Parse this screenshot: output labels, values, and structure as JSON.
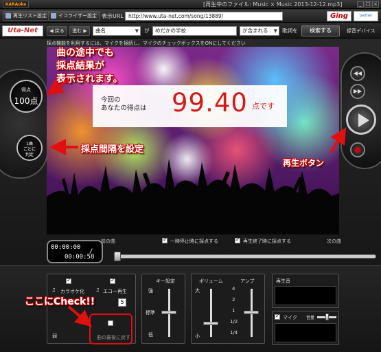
{
  "titlebar": {
    "logo_text": "KARAoke",
    "title": "[再生中のファイル: Music × Music  2013-12-12.mp3]",
    "buttons": [
      "_",
      "□",
      "×"
    ]
  },
  "toolbar": {
    "playlist_label": "再生リスト設定",
    "equalizer_label": "イコライザー設定",
    "url_label": "表示URL :",
    "url_value": "http://www.uta-net.com/song/13889/",
    "ging_logo": "Ging",
    "partner_logo": "partner"
  },
  "searchbar": {
    "site_logo": "Uta-Net",
    "back_label": "◀ 戻る",
    "forward_label": "進む ▶",
    "field1_select": "曲名",
    "particle_ga": "が",
    "field1_value": "めだかの学校",
    "match_select": "が含まれる",
    "lyrics_label": "歌詞を",
    "search_button": "検索する",
    "device_label": "録音デバイス"
  },
  "stage": {
    "notice": "採点機能を利用するには、マイクを接続し、マイクのチェックボックスをONにしてください",
    "score_caption_line1": "今回の",
    "score_caption_line2": "あなたの得点は",
    "score_value": "99.40",
    "score_unit": "点です"
  },
  "left_panel": {
    "score_label": "得点",
    "score_value": "100点",
    "interval_line1": "1曲",
    "interval_line2": "ごとに",
    "interval_line3": "判定"
  },
  "annotations": {
    "mid_line1": "曲の途中でも",
    "mid_line2": "採点結果が",
    "mid_line3": "表示されます。",
    "interval": "採点間隔を設定",
    "play": "再生ボタン",
    "check": "ここにCheck!!"
  },
  "transport": {
    "time_current": "00:00:00",
    "time_total": "00:00:58",
    "time_sep": "/",
    "prev_song": "前の曲",
    "next_song": "次の曲",
    "pause_score_label": "一時停止時に採点する",
    "end_score_label": "再生終了時に採点する",
    "progress": 0
  },
  "bottom": {
    "karaoke_label": "カラオケ化",
    "echo_label": "エコー再生",
    "echo_value": "5",
    "weak_label": "弱",
    "sync_label": "曲の最後に戻す",
    "key_label": "キー設定",
    "key_high": "強",
    "key_std": "標準",
    "key_low": "低",
    "volume_label": "ボリューム",
    "vol_high": "大",
    "vol_low": "小",
    "amp_label": "アンプ",
    "amp_ticks": [
      "4",
      "2",
      "1",
      "1/2",
      "1/4"
    ],
    "playback_label": "再生音",
    "mic_label": "マイク",
    "mic_vol_label": "音量"
  },
  "colors": {
    "accent_red": "#e01010",
    "score_red": "#d41a1a"
  }
}
